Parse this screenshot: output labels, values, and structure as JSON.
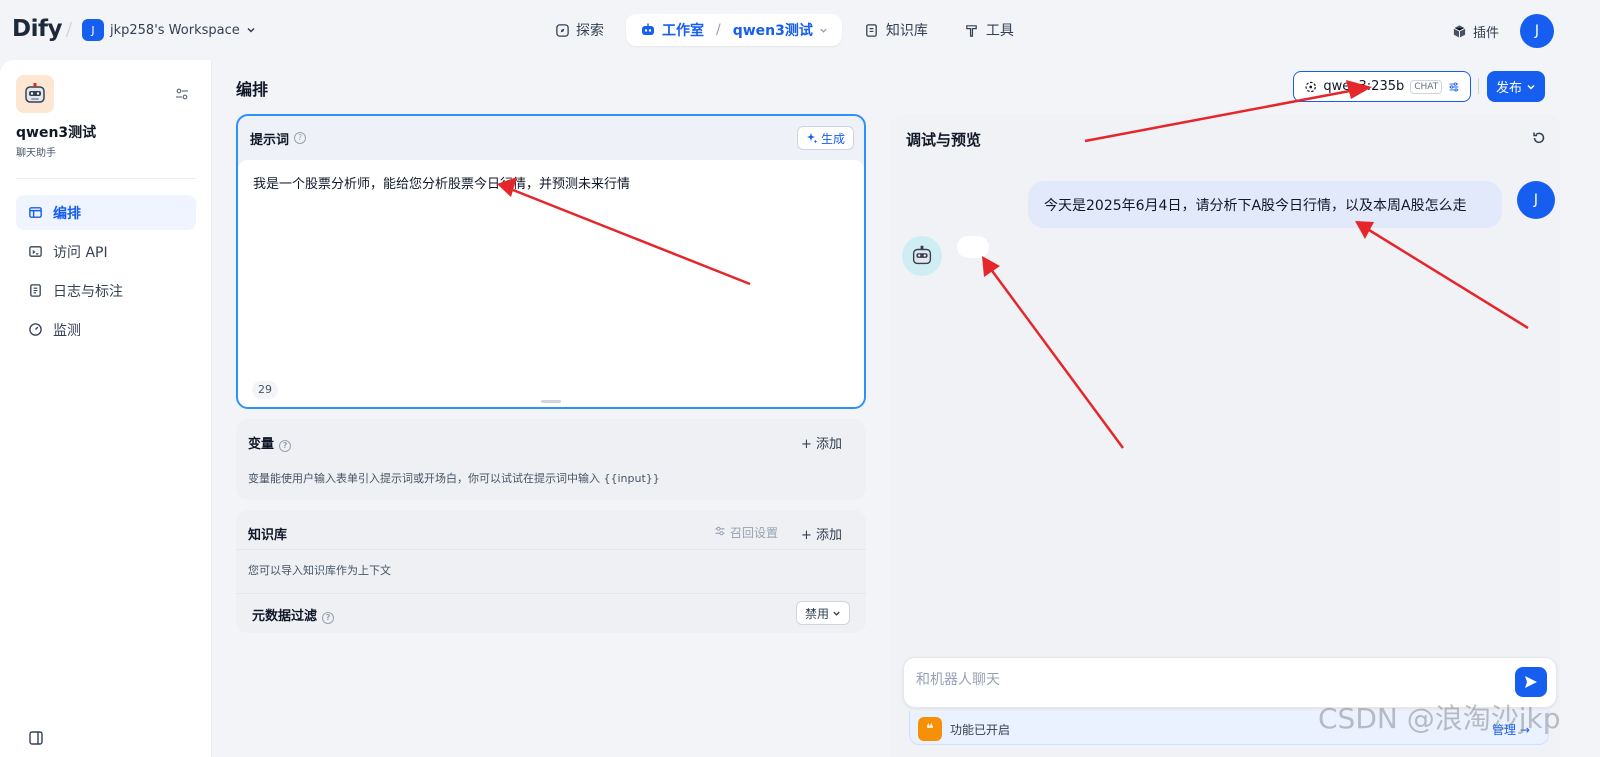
{
  "top": {
    "logo": "Dify",
    "workspace_initial": "J",
    "workspace_name": "jkp258's Workspace",
    "nav": [
      {
        "label": "探索"
      },
      {
        "label": "工作室"
      },
      {
        "label": "知识库"
      },
      {
        "label": "工具"
      }
    ],
    "current_app": "qwen3测试",
    "plugin_label": "插件",
    "user_initial": "J"
  },
  "sidebar": {
    "app_name": "qwen3测试",
    "app_type": "聊天助手",
    "items": [
      {
        "label": "编排"
      },
      {
        "label": "访问 API"
      },
      {
        "label": "日志与标注"
      },
      {
        "label": "监测"
      }
    ]
  },
  "main": {
    "title": "编排",
    "model_name": "qwen3:235b",
    "model_badge": "CHAT",
    "publish_label": "发布"
  },
  "prompt": {
    "title": "提示词",
    "generate_label": "生成",
    "text": "我是一个股票分析师，能给您分析股票今日行情，并预测未来行情",
    "count": "29"
  },
  "variables": {
    "title": "变量",
    "add_label": "添加",
    "desc": "变量能使用户输入表单引入提示词或开场白，你可以试试在提示词中输入 {{input}}"
  },
  "knowledge": {
    "title": "知识库",
    "recall_label": "召回设置",
    "add_label": "添加",
    "desc": "您可以导入知识库作为上下文",
    "meta_title": "元数据过滤",
    "meta_value": "禁用"
  },
  "debug": {
    "title": "调试与预览",
    "user_message": "今天是2025年6月4日，请分析下A股今日行情，以及本周A股怎么走",
    "user_initial": "J",
    "input_placeholder": "和机器人聊天",
    "feature_text": "功能已开启",
    "manage_label": "管理"
  },
  "watermark": "CSDN @浪淘沙jkp",
  "colors": {
    "accent": "#155eef",
    "annotation_arrow": "#e5262b"
  }
}
